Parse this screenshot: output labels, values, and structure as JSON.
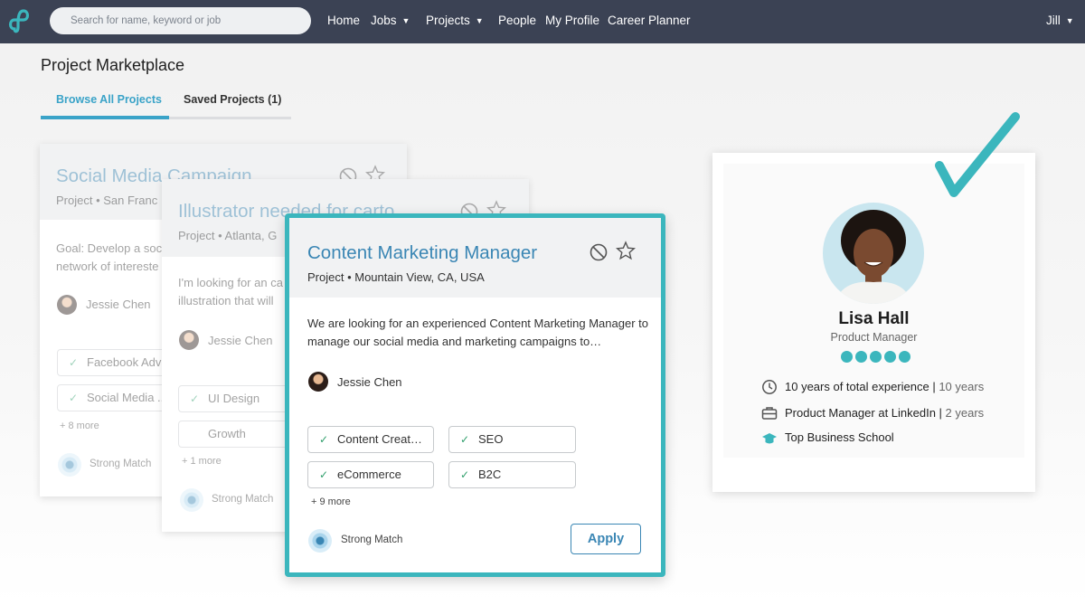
{
  "search": {
    "placeholder": "Search for name, keyword or job"
  },
  "nav": {
    "items": [
      {
        "label": "Home",
        "caret": false
      },
      {
        "label": "Jobs",
        "caret": true
      },
      {
        "label": "Projects",
        "caret": true
      },
      {
        "label": "People",
        "caret": false
      },
      {
        "label": "My Profile",
        "caret": false
      },
      {
        "label": "Career Planner",
        "caret": false
      }
    ],
    "user": "Jill"
  },
  "page": {
    "title": "Project Marketplace",
    "tabs": [
      {
        "label": "Browse All Projects",
        "active": true
      },
      {
        "label": "Saved Projects (1)",
        "active": false
      }
    ]
  },
  "colors": {
    "accent": "#3bb6bd",
    "link": "#3a86b4",
    "topbar": "#3b4254",
    "check": "#2f9e6b"
  },
  "cards": [
    {
      "title": "Social Media Campaign",
      "meta": "Project • San Franc",
      "description": "Goal: Develop a soc network of intereste",
      "person": "Jessie Chen",
      "skills": [
        "Facebook Adv",
        "Social Media ..."
      ],
      "more": "+ 8 more",
      "match": "Strong Match"
    },
    {
      "title": "Illustrator needed for carto",
      "meta": "Project • Atlanta, G",
      "description": "I'm looking for an ca illustration that will",
      "person": "Jessie Chen",
      "skills": [
        "UI Design",
        "Growth"
      ],
      "more": "+ 1 more",
      "match": "Strong Match"
    },
    {
      "title": "Content Marketing Manager",
      "meta": "Project • Mountain View, CA, USA",
      "description": "We are looking for an experienced Content Marketing Manager to manage our social media and marketing campaigns to…",
      "person": "Jessie Chen",
      "skills": [
        "Content Creat…",
        "SEO",
        "eCommerce",
        "B2C"
      ],
      "more": "+ 9 more",
      "match": "Strong Match",
      "apply": "Apply"
    }
  ],
  "profile": {
    "name": "Lisa Hall",
    "role": "Product Manager",
    "rating": 5,
    "experience": {
      "main": "10 years of total experience",
      "detail": "10 years"
    },
    "position": {
      "main": "Product Manager at LinkedIn",
      "detail": "2 years"
    },
    "education": "Top Business School"
  },
  "icons": [
    "logo-icon",
    "caret-down-icon",
    "ban-icon",
    "star-icon",
    "check-icon",
    "clock-icon",
    "briefcase-icon",
    "graduation-cap-icon",
    "match-icon"
  ]
}
